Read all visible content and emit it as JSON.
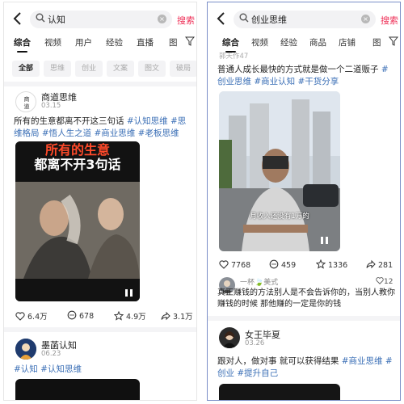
{
  "left": {
    "search": {
      "query": "认知",
      "button": "搜索"
    },
    "tabs": [
      "综合",
      "视频",
      "用户",
      "经验",
      "直播",
      "图"
    ],
    "chips": [
      "全部",
      "思维",
      "创业",
      "文案",
      "图文",
      "破局"
    ],
    "post1": {
      "author": "商道思维",
      "avatar_text": "商\n道",
      "date": "03.15",
      "text": "所有的生意都离不开这三句话",
      "tags": [
        "#认知思维",
        "#思维格局",
        "#悟人生之道",
        "#商业思维",
        "#老板思维"
      ],
      "image_caption_line1": "所有的生意",
      "image_caption_line2": "都离不开3句话",
      "likes": "6.4万",
      "comments": "678",
      "favorites": "4.9万",
      "shares": "3.1万"
    },
    "post2": {
      "author": "墨菡认知",
      "date": "06.23",
      "tags": [
        "#认知",
        "#认知思维"
      ]
    }
  },
  "right": {
    "search": {
      "query": "创业思维",
      "button": "搜索"
    },
    "tabs": [
      "综合",
      "视频",
      "经验",
      "商品",
      "店铺",
      "图"
    ],
    "post1": {
      "author_partial": "郭天作47",
      "text": "普通人成长最快的方式就是做一个二道贩子",
      "tags": [
        "#创业思维",
        "#商业认知",
        "#干货分享"
      ],
      "subtitle": "月收入还没有1万的",
      "likes": "7768",
      "comments": "459",
      "favorites": "1336",
      "shares": "281"
    },
    "comment": {
      "user": "一杯🍃美式",
      "likes": "12",
      "text": "真正赚钱的方法别人是不会告诉你的，当别人教你赚钱的时候 那他赚的一定是你的钱"
    },
    "post2": {
      "author": "女王毕夏",
      "date": "03.26",
      "text": "跟对人，做对事 就可以获得结果",
      "tags": [
        "#商业思维",
        "#创业",
        "#提升自己"
      ]
    }
  },
  "colors": {
    "accent": "#ee2d55",
    "tag": "#3b6fb6"
  }
}
